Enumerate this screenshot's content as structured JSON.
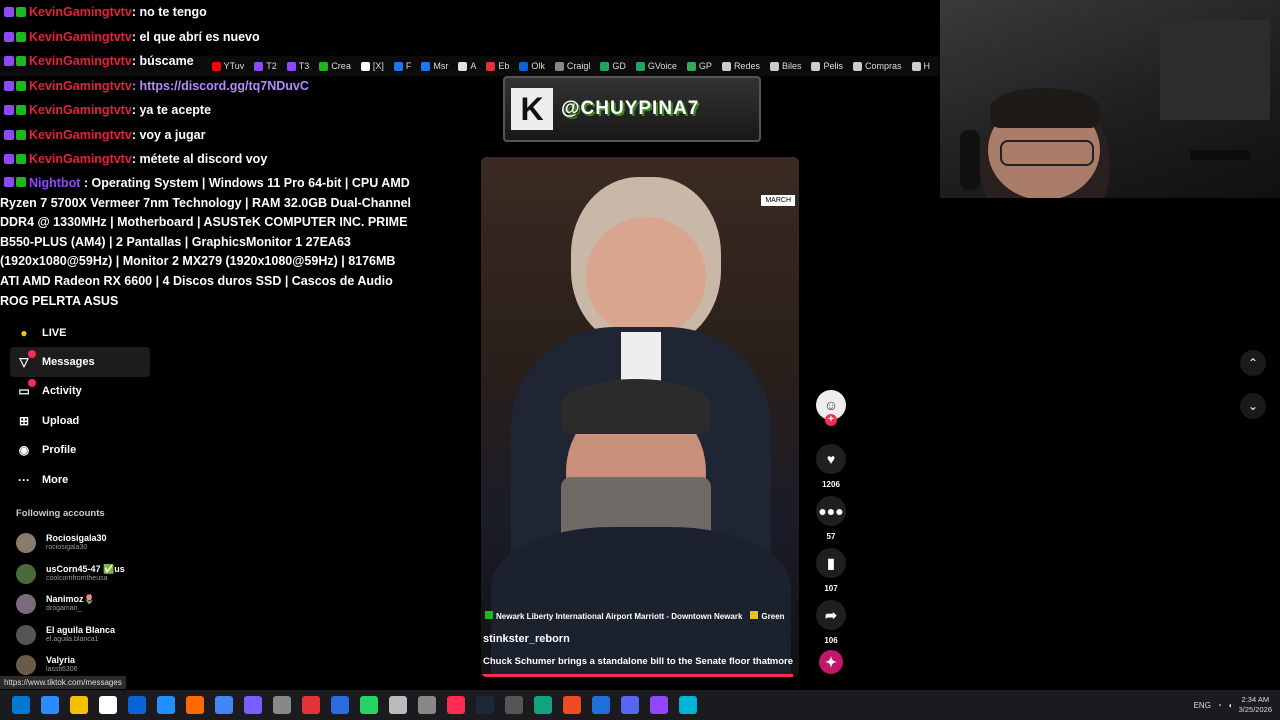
{
  "bookmarks": [
    {
      "label": "YTuv",
      "color": "#ff0000"
    },
    {
      "label": "T2",
      "color": "#9147ff"
    },
    {
      "label": "T3",
      "color": "#9147ff"
    },
    {
      "label": "Crea",
      "color": "#1fb61f"
    },
    {
      "label": "[X]",
      "color": "#ffffff"
    },
    {
      "label": "F",
      "color": "#1877f2"
    },
    {
      "label": "Msr",
      "color": "#1877f2"
    },
    {
      "label": "A",
      "color": "#e0e0e0"
    },
    {
      "label": "Eb",
      "color": "#e53238"
    },
    {
      "label": "Olk",
      "color": "#0a64d6"
    },
    {
      "label": "Craigl",
      "color": "#888888"
    },
    {
      "label": "GD",
      "color": "#1fa463"
    },
    {
      "label": "GVoice",
      "color": "#1fa463"
    },
    {
      "label": "GP",
      "color": "#34a853"
    },
    {
      "label": "Redes",
      "color": "#cccccc"
    },
    {
      "label": "Biles",
      "color": "#cccccc"
    },
    {
      "label": "Pelis",
      "color": "#cccccc"
    },
    {
      "label": "Compras",
      "color": "#cccccc"
    },
    {
      "label": "H",
      "color": "#cccccc"
    }
  ],
  "chat": [
    {
      "user": "KevinGamingtvtv",
      "msg": ": no te tengo",
      "type": "user"
    },
    {
      "user": "KevinGamingtvtv",
      "msg": ": el que abrí es nuevo",
      "type": "user"
    },
    {
      "user": "KevinGamingtvtv",
      "msg": ": búscame",
      "type": "user"
    },
    {
      "user": "KevinGamingtvtv",
      "msg": ": https://discord.gg/tq7NDuvC",
      "type": "link"
    },
    {
      "user": "KevinGamingtvtv",
      "msg": ": ya te acepte",
      "type": "user"
    },
    {
      "user": "KevinGamingtvtv",
      "msg": ": voy a jugar",
      "type": "user"
    },
    {
      "user": "KevinGamingtvtv",
      "msg": ": métete al discord voy",
      "type": "user"
    }
  ],
  "nightbot": {
    "user": "Nightbot",
    "msg": " : Operating System | Windows 11 Pro 64-bit | CPU AMD Ryzen 7 5700X Vermeer 7nm Technology | RAM 32.0GB Dual-Channel DDR4 @ 1330MHz | Motherboard | ASUSTeK COMPUTER INC. PRIME B550-PLUS (AM4) | 2 Pantallas | GraphicsMonitor 1 27EA63 (1920x1080@59Hz) | Monitor 2 MX279 (1920x1080@59Hz) | 8176MB ATI AMD Radeon RX 6600 | 4 Discos duros SSD | Cascos de Audio ROG PELRTA ASUS"
  },
  "sidebar": {
    "items": [
      {
        "label": "LIVE",
        "icon": "live-icon",
        "glyph": "●"
      },
      {
        "label": "Messages",
        "icon": "messages-icon",
        "glyph": "▽"
      },
      {
        "label": "Activity",
        "icon": "activity-icon",
        "glyph": "▭"
      },
      {
        "label": "Upload",
        "icon": "upload-icon",
        "glyph": "⊞"
      },
      {
        "label": "Profile",
        "icon": "profile-icon",
        "glyph": "◉"
      },
      {
        "label": "More",
        "icon": "more-icon",
        "glyph": "···"
      }
    ],
    "following_title": "Following accounts",
    "accounts": [
      {
        "name": "Rociosigala30",
        "handle": "rociosigala30"
      },
      {
        "name": "usCorn45-47 ✅us",
        "handle": "coolcornfromtheusa"
      },
      {
        "name": "Nanimoz🌷",
        "handle": "drogaman_"
      },
      {
        "name": "El aguila Blanca",
        "handle": "el.aguila.blanca1"
      },
      {
        "name": "Valyria",
        "handle": "lassfi6306"
      }
    ]
  },
  "banner": {
    "letter": "K",
    "handle": "@CHUYPINA7"
  },
  "video": {
    "date_tag": "MARCH",
    "location": "Newark Liberty International Airport Marriott - Downtown Newark",
    "tag2": "Green",
    "username": "stinkster_reborn",
    "description": "Chuck Schumer brings a standalone bill to the Senate floor that",
    "more": "more",
    "progress": 0.98
  },
  "actions": {
    "likes": "1206",
    "comments": "57",
    "saves": "107",
    "shares": "106"
  },
  "status_url": "https://www.tiktok.com/messages",
  "tray": {
    "lang": "ENG",
    "time": "2:34 AM",
    "date": "3/25/2026"
  },
  "colors": {
    "accent": "#fe2c55",
    "twitch": "#9147ff",
    "chat_user": "#e0243a"
  }
}
